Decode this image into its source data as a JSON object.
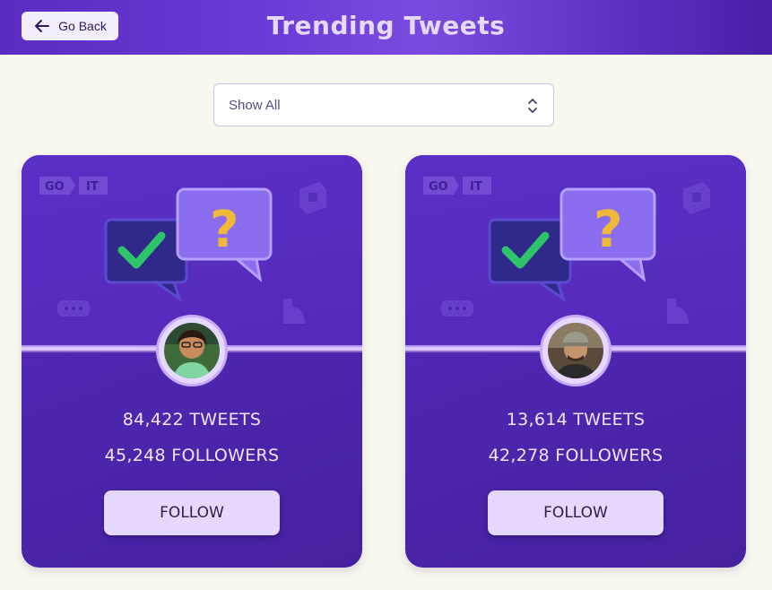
{
  "header": {
    "back_label": "Go Back",
    "title": "Trending Tweets"
  },
  "filter": {
    "selected": "Show All"
  },
  "cards": [
    {
      "tweets": "84,422 TWEETS",
      "followers": "45,248 FOLLOWERS",
      "follow_label": "FOLLOW",
      "logo_left": "GO",
      "logo_right": "IT"
    },
    {
      "tweets": "13,614 TWEETS",
      "followers": "42,278 FOLLOWERS",
      "follow_label": "FOLLOW",
      "logo_left": "GO",
      "logo_right": "IT"
    }
  ],
  "colors": {
    "header_accent": "#6b3bd6",
    "card_bg": "#4e27b0",
    "button_bg": "#e6d8fb",
    "page_bg": "#f8f8ee"
  },
  "icons": [
    "arrow-left-icon",
    "chevron-up-down-icon",
    "check-bubble-icon",
    "question-bubble-icon"
  ]
}
